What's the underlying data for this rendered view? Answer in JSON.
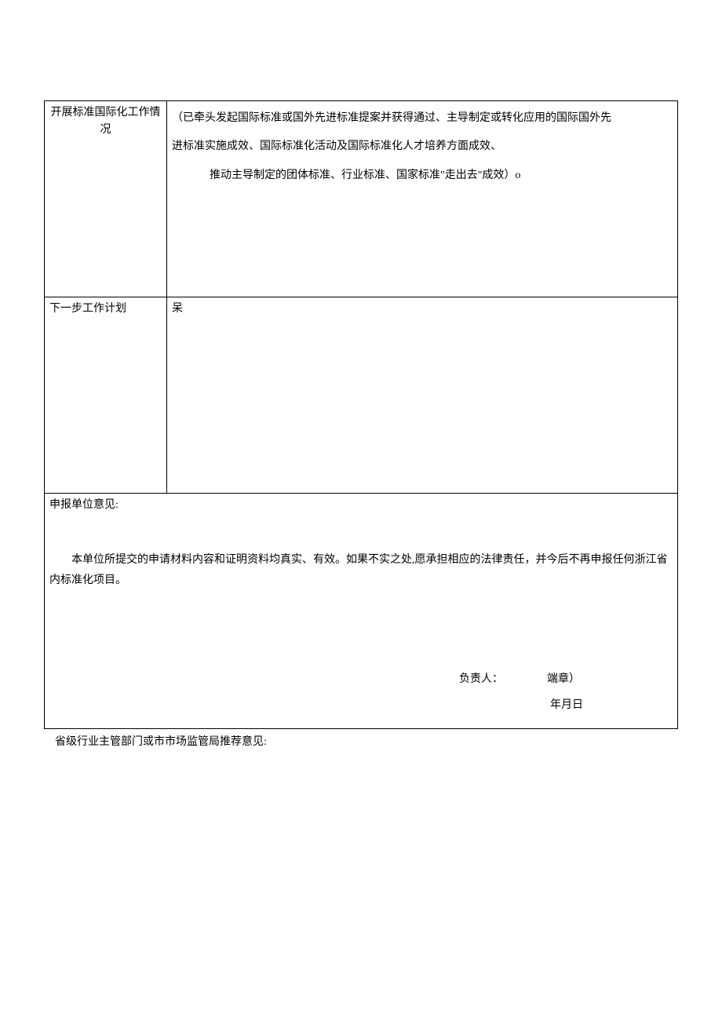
{
  "row1": {
    "label_line1": "开展标准国际化工作情",
    "label_line2": "况",
    "content_line1": "（已牵头发起国际标准或国外先进标准提案并获得通过、主导制定或转化应用的国际国外先",
    "content_line2": "进标准实施成效、国际标准化活动及国际标准化人才培养方面成效、",
    "content_line3": "推动主导制定的团体标准、行业标准、国家标准\"走出去\"成效）o"
  },
  "row2": {
    "label": "下一步工作计划",
    "content": "呆"
  },
  "row3": {
    "title": "申报单位意见:",
    "declaration": "本单位所提交的申请材料内容和证明资料均真实、有效。如果不实之处,愿承担相应的法律责任，并今后不再申报任何浙江省内标准化项目。",
    "responsible_label": "负责人：",
    "seal_label": "端章）",
    "date_label": "年月日"
  },
  "below_text": "省级行业主管部门或市市场监管局推荐意见:"
}
